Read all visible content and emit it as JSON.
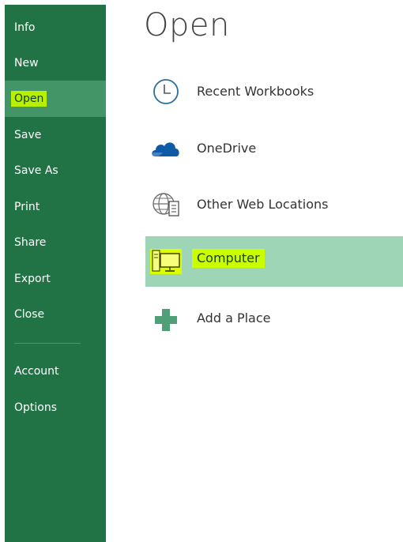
{
  "sidebar": {
    "items": [
      {
        "label": "Info"
      },
      {
        "label": "New"
      },
      {
        "label": "Open"
      },
      {
        "label": "Save"
      },
      {
        "label": "Save As"
      },
      {
        "label": "Print"
      },
      {
        "label": "Share"
      },
      {
        "label": "Export"
      },
      {
        "label": "Close"
      },
      {
        "label": "Account"
      },
      {
        "label": "Options"
      }
    ],
    "active": "Open"
  },
  "main": {
    "title": "Open",
    "places": [
      {
        "label": "Recent Workbooks",
        "icon": "clock-icon"
      },
      {
        "label": "OneDrive",
        "icon": "cloud-icon"
      },
      {
        "label": "Other Web Locations",
        "icon": "globe-icon"
      },
      {
        "label": "Computer",
        "icon": "computer-icon"
      },
      {
        "label": "Add a Place",
        "icon": "plus-icon"
      }
    ],
    "selected": "Computer"
  },
  "colors": {
    "sidebar_bg": "#217346",
    "sidebar_active": "#439467",
    "selected_place": "#9fd5b7",
    "highlight": "#c9ff00",
    "onedrive_blue": "#0f5aa7"
  }
}
